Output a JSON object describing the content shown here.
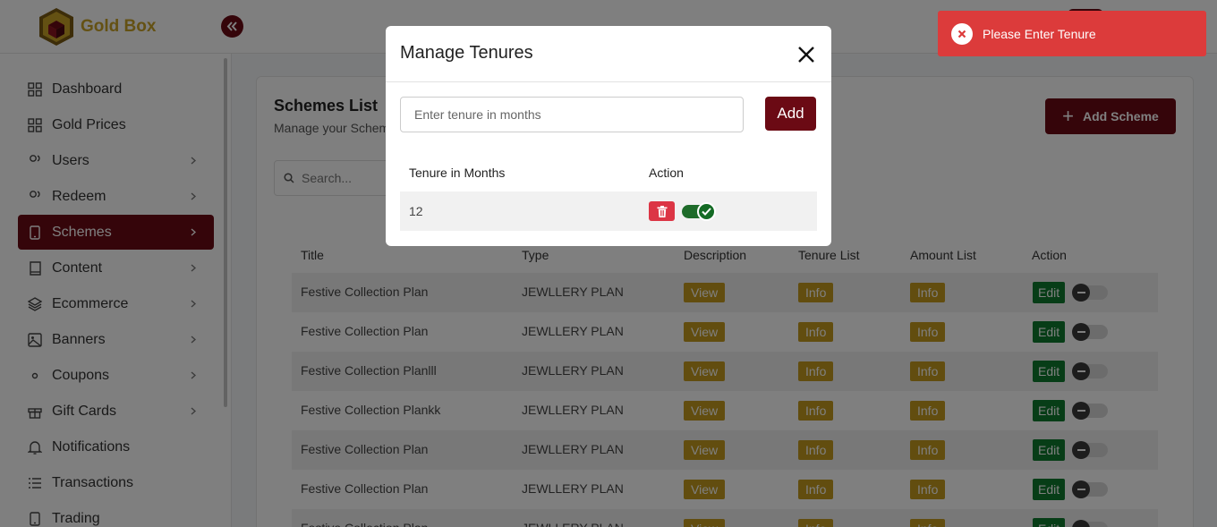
{
  "app": {
    "brand": "Gold Box"
  },
  "sidebar": {
    "items": [
      {
        "label": "Dashboard",
        "icon": "grid-icon",
        "has_chevron": false,
        "active": false
      },
      {
        "label": "Gold Prices",
        "icon": "grid-icon",
        "has_chevron": false,
        "active": false
      },
      {
        "label": "Users",
        "icon": "users-icon",
        "has_chevron": true,
        "active": false
      },
      {
        "label": "Redeem",
        "icon": "users-icon",
        "has_chevron": true,
        "active": false
      },
      {
        "label": "Schemes",
        "icon": "phone-icon",
        "has_chevron": true,
        "active": true
      },
      {
        "label": "Content",
        "icon": "book-icon",
        "has_chevron": true,
        "active": false
      },
      {
        "label": "Ecommerce",
        "icon": "layers-icon",
        "has_chevron": true,
        "active": false
      },
      {
        "label": "Banners",
        "icon": "image-icon",
        "has_chevron": true,
        "active": false
      },
      {
        "label": "Coupons",
        "icon": "eye-icon",
        "has_chevron": true,
        "active": false
      },
      {
        "label": "Gift Cards",
        "icon": "gift-icon",
        "has_chevron": true,
        "active": false
      },
      {
        "label": "Notifications",
        "icon": "bell-icon",
        "has_chevron": false,
        "active": false
      },
      {
        "label": "Transactions",
        "icon": "list-icon",
        "has_chevron": false,
        "active": false
      },
      {
        "label": "Trading",
        "icon": "phone-icon",
        "has_chevron": false,
        "active": false
      }
    ]
  },
  "page": {
    "title": "Schemes List",
    "subtitle": "Manage your Schem",
    "add_button": "Add Scheme",
    "search_placeholder": "Search..."
  },
  "table": {
    "columns": [
      "Title",
      "Type",
      "Description",
      "Tenure List",
      "Amount List",
      "Action"
    ],
    "rows": [
      {
        "title": "Festive Collection Plan",
        "type": "JEWLLERY PLAN",
        "description": "View",
        "tenure": "Info",
        "amount": "Info",
        "action": "Edit"
      },
      {
        "title": "Festive Collection Plan",
        "type": "JEWLLERY PLAN",
        "description": "View",
        "tenure": "Info",
        "amount": "Info",
        "action": "Edit"
      },
      {
        "title": "Festive Collection Planlll",
        "type": "JEWLLERY PLAN",
        "description": "View",
        "tenure": "Info",
        "amount": "Info",
        "action": "Edit"
      },
      {
        "title": "Festive Collection Plankk",
        "type": "JEWLLERY PLAN",
        "description": "View",
        "tenure": "Info",
        "amount": "Info",
        "action": "Edit"
      },
      {
        "title": "Festive Collection Plan",
        "type": "JEWLLERY PLAN",
        "description": "View",
        "tenure": "Info",
        "amount": "Info",
        "action": "Edit"
      },
      {
        "title": "Festive Collection Plan",
        "type": "JEWLLERY PLAN",
        "description": "View",
        "tenure": "Info",
        "amount": "Info",
        "action": "Edit"
      },
      {
        "title": "Festive Collection Plan",
        "type": "JEWLLERY PLAN",
        "description": "View",
        "tenure": "Info",
        "amount": "Info",
        "action": "Edit"
      }
    ]
  },
  "modal": {
    "title": "Manage Tenures",
    "input_placeholder": "Enter tenure in months",
    "input_value": "",
    "add_label": "Add",
    "columns": [
      "Tenure in Months",
      "Action"
    ],
    "rows": [
      {
        "tenure": "12",
        "enabled": true
      }
    ]
  },
  "toast": {
    "message": "Please Enter Tenure",
    "type": "error"
  },
  "colors": {
    "brand": "#6b0a14",
    "gold": "#c49b1f",
    "success": "#0f7a2f",
    "danger": "#dc3545",
    "toast": "#dc3b3b"
  }
}
